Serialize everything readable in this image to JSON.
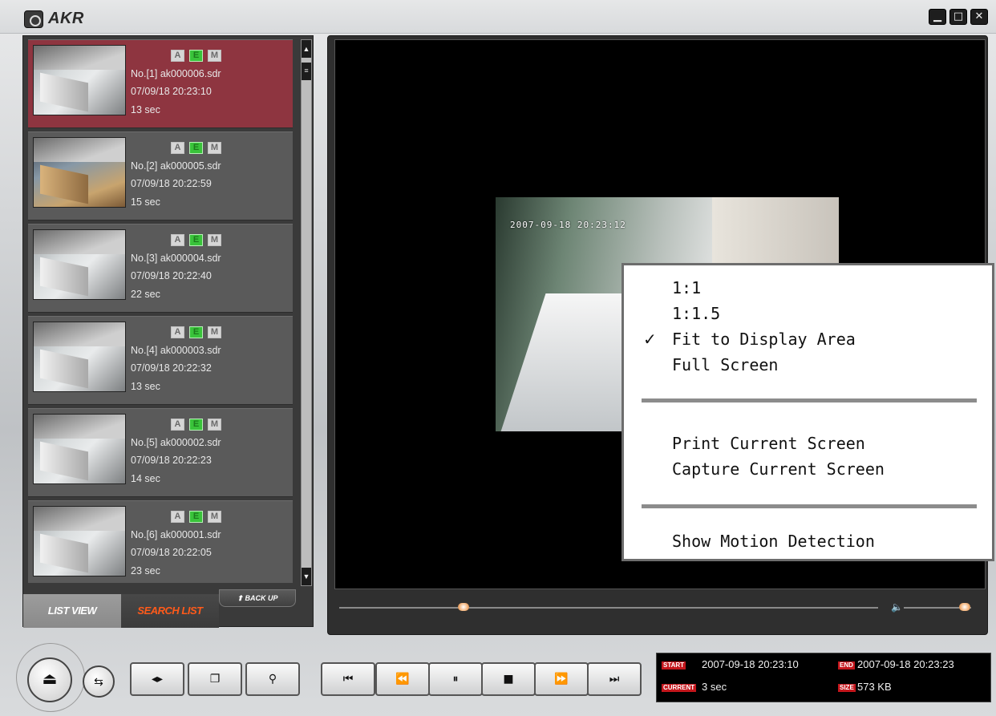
{
  "app": {
    "title": "AKR",
    "window_buttons": [
      "minimize-icon",
      "maximize-icon",
      "close-icon"
    ]
  },
  "list": {
    "items": [
      {
        "no": "No.[1] ak000006.sdr",
        "datetime": "07/09/18 20:23:10",
        "duration": "13 sec",
        "badges": [
          "A",
          "E",
          "M"
        ]
      },
      {
        "no": "No.[2] ak000005.sdr",
        "datetime": "07/09/18 20:22:59",
        "duration": "15 sec",
        "badges": [
          "A",
          "E",
          "M"
        ]
      },
      {
        "no": "No.[3] ak000004.sdr",
        "datetime": "07/09/18 20:22:40",
        "duration": "22 sec",
        "badges": [
          "A",
          "E",
          "M"
        ]
      },
      {
        "no": "No.[4] ak000003.sdr",
        "datetime": "07/09/18 20:22:32",
        "duration": "13 sec",
        "badges": [
          "A",
          "E",
          "M"
        ]
      },
      {
        "no": "No.[5] ak000002.sdr",
        "datetime": "07/09/18 20:22:23",
        "duration": "14 sec",
        "badges": [
          "A",
          "E",
          "M"
        ]
      },
      {
        "no": "No.[6] ak000001.sdr",
        "datetime": "07/09/18 20:22:05",
        "duration": "23 sec",
        "badges": [
          "A",
          "E",
          "M"
        ]
      }
    ],
    "tabs": {
      "list_view": "LIST VIEW",
      "search_list": "SEARCH LIST"
    },
    "backup_label": "BACK UP"
  },
  "video": {
    "osd_timestamp": "2007-09-18 20:23:12",
    "seek_fraction": 0.23,
    "volume_fraction": 0.9
  },
  "context_menu": {
    "items": [
      "1:1",
      "1:1.5",
      "Fit to Display Area",
      "Full Screen",
      "Print Current Screen",
      "Capture Current Screen",
      "Show Motion Detection"
    ],
    "checked_index": 2
  },
  "playback": {
    "buttons": [
      "first-icon",
      "rewind-icon",
      "pause-icon",
      "stop-icon",
      "fast-forward-icon",
      "last-icon"
    ]
  },
  "info": {
    "start_tag": "START",
    "start_value": "2007-09-18 20:23:10",
    "end_tag": "END",
    "end_value": "2007-09-18 20:23:23",
    "current_tag": "CURRENT",
    "current_value": "3 sec",
    "size_tag": "SIZE",
    "size_value": "573 KB"
  },
  "colors": {
    "selected_item": "#8e3540",
    "search_tab": "#ff5a1a",
    "accent_red": "#c4161c"
  }
}
